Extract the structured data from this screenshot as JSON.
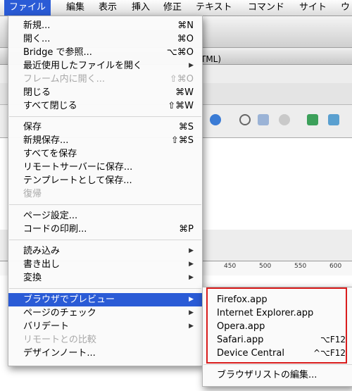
{
  "menubar": {
    "items": [
      {
        "label": "ファイル"
      },
      {
        "label": "編集"
      },
      {
        "label": "表示"
      },
      {
        "label": "挿入"
      },
      {
        "label": "修正"
      },
      {
        "label": "テキスト"
      },
      {
        "label": "コマンド"
      },
      {
        "label": "サイト"
      },
      {
        "label": "ウ"
      }
    ]
  },
  "background": {
    "doc_title": "TML)",
    "ruler": [
      "450",
      "500",
      "550",
      "600"
    ]
  },
  "file_menu": {
    "items": [
      {
        "label": "新規...",
        "shortcut": "⌘N"
      },
      {
        "label": "開く...",
        "shortcut": "⌘O"
      },
      {
        "label": "Bridge で参照...",
        "shortcut": "⌥⌘O"
      },
      {
        "label": "最近使用したファイルを開く",
        "shortcut": ""
      },
      {
        "label": "フレーム内に開く...",
        "shortcut": "⇧⌘O"
      },
      {
        "label": "閉じる",
        "shortcut": "⌘W"
      },
      {
        "label": "すべて閉じる",
        "shortcut": "⇧⌘W"
      },
      {
        "label": "保存",
        "shortcut": "⌘S"
      },
      {
        "label": "新規保存...",
        "shortcut": "⇧⌘S"
      },
      {
        "label": "すべてを保存",
        "shortcut": ""
      },
      {
        "label": "リモートサーバーに保存...",
        "shortcut": ""
      },
      {
        "label": "テンプレートとして保存...",
        "shortcut": ""
      },
      {
        "label": "復帰",
        "shortcut": ""
      },
      {
        "label": "ページ設定...",
        "shortcut": ""
      },
      {
        "label": "コードの印刷...",
        "shortcut": "⌘P"
      },
      {
        "label": "読み込み",
        "shortcut": ""
      },
      {
        "label": "書き出し",
        "shortcut": ""
      },
      {
        "label": "変換",
        "shortcut": ""
      },
      {
        "label": "ブラウザでプレビュー",
        "shortcut": ""
      },
      {
        "label": "ページのチェック",
        "shortcut": ""
      },
      {
        "label": "バリデート",
        "shortcut": ""
      },
      {
        "label": "リモートとの比較",
        "shortcut": ""
      },
      {
        "label": "デザインノート...",
        "shortcut": ""
      }
    ]
  },
  "preview_submenu": {
    "items": [
      {
        "label": "Firefox.app",
        "shortcut": ""
      },
      {
        "label": "Internet Explorer.app",
        "shortcut": ""
      },
      {
        "label": "Opera.app",
        "shortcut": ""
      },
      {
        "label": "Safari.app",
        "shortcut": "⌥F12"
      },
      {
        "label": "Device Central",
        "shortcut": "^⌥F12"
      },
      {
        "label": "ブラウザリストの編集...",
        "shortcut": ""
      }
    ]
  },
  "colors": {
    "selection": "#2a5bd6",
    "highlight_box": "#d91c1c"
  }
}
